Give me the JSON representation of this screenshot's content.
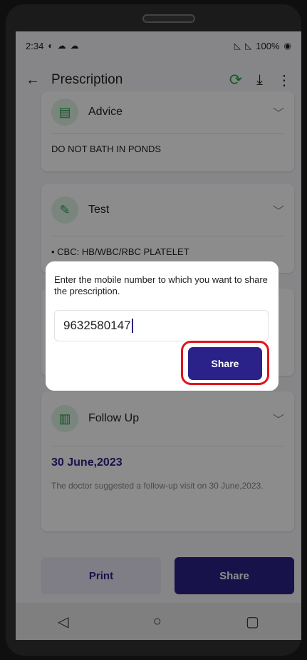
{
  "status_bar": {
    "time": "2:34",
    "battery": "100%"
  },
  "app_bar": {
    "title": "Prescription"
  },
  "sections": {
    "advice": {
      "title": "Advice",
      "content": "DO NOT BATH IN PONDS"
    },
    "test": {
      "title": "Test",
      "content": "• CBC: HB/WBC/RBC PLATELET"
    },
    "follow_up": {
      "title": "Follow Up",
      "date": "30 June,2023",
      "note": "The doctor suggested a follow-up visit on 30 June,2023."
    }
  },
  "bottom_buttons": {
    "print_label": "Print",
    "share_label": "Share"
  },
  "dialog": {
    "message": "Enter the mobile number to which you want to share the prescription.",
    "input_value": "9632580147",
    "share_label": "Share"
  },
  "colors": {
    "primary": "#2a2288",
    "accent_green": "#2e9e4d",
    "highlight_red": "#e0141c"
  },
  "icons": {
    "back": "arrow-left-icon",
    "refresh": "refresh-icon",
    "download": "download-icon",
    "more": "more-vert-icon",
    "nav_back": "nav-back-icon",
    "nav_home": "nav-home-icon",
    "nav_recents": "nav-recents-icon"
  }
}
